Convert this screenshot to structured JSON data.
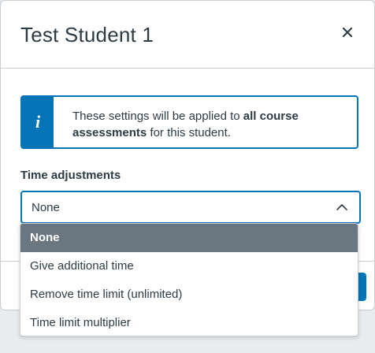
{
  "modal": {
    "title": "Test Student 1",
    "close_icon": "close-icon"
  },
  "alert": {
    "icon": "info-icon",
    "icon_glyph": "i",
    "text_before": "These settings will be applied to ",
    "text_bold": "all course assessments",
    "text_after": " for this student.",
    "accent": "#0374b5"
  },
  "time_adjustments": {
    "label": "Time adjustments",
    "selected_value": "None",
    "caret_icon": "chevron-up-icon",
    "options": [
      {
        "label": "None",
        "selected": true
      },
      {
        "label": "Give additional time",
        "selected": false
      },
      {
        "label": "Remove time limit (unlimited)",
        "selected": false
      },
      {
        "label": "Time limit multiplier",
        "selected": false
      }
    ]
  },
  "colors": {
    "primary": "#0374b5",
    "selected_option_bg": "#6b7780",
    "text": "#2d3b45",
    "border": "#c7cdd1"
  }
}
